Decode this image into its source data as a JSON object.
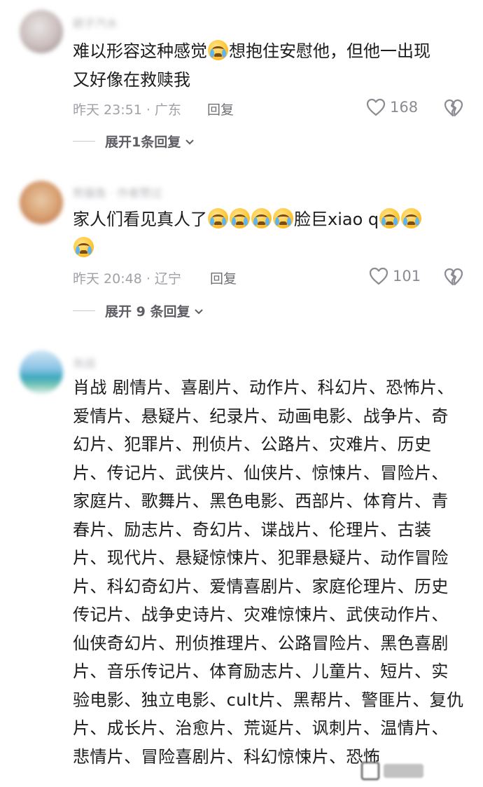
{
  "comments": [
    {
      "username": "颖子汽水",
      "text_a": "难以形容这种感觉",
      "text_b": "想抱住安慰他，但他一出现\n又好像在救赎我",
      "time": "昨天 23:51 · 广东",
      "reply_label": "回复",
      "likes": "168",
      "expand": "展开1条回复",
      "emoji": "crying-face"
    },
    {
      "username": "熊猫鱼 · 作者赞过",
      "text_a": "家人们看见真人了",
      "text_b": "脸巨xiao q",
      "time": "昨天 20:48 · 辽宁",
      "reply_label": "回复",
      "likes": "101",
      "expand": "展开 9 条回复",
      "emoji": "loudly-crying-face"
    },
    {
      "username": "肖战",
      "text": "肖战 剧情片、喜剧片、动作片、科幻片、恐怖片、爱情片、悬疑片、纪录片、动画电影、战争片、奇幻片、犯罪片、刑侦片、公路片、灾难片、历史片、传记片、武侠片、仙侠片、惊悚片、冒险片、家庭片、歌舞片、黑色电影、西部片、体育片、青春片、励志片、奇幻片、谍战片、伦理片、古装片、现代片、悬疑惊悚片、犯罪悬疑片、动作冒险片、科幻奇幻片、爱情喜剧片、家庭伦理片、历史传记片、战争史诗片、灾难惊悚片、武侠动作片、仙侠奇幻片、刑侦推理片、公路冒险片、黑色喜剧片、音乐传记片、体育励志片、儿童片、短片、实验电影、独立电影、cult片、黑帮片、警匪片、复仇片、成长片、治愈片、荒诞片、讽刺片、温情片、悲情片、冒险喜剧片、科幻惊悚片、恐怖"
    }
  ],
  "icons": {
    "heart": "heart-outline-icon",
    "dislike": "broken-heart-icon",
    "chevron": "chevron-down-icon"
  },
  "colors": {
    "text": "#1c1c1e",
    "meta": "#a0a0a8",
    "tear": "#5fb4ef",
    "emoji": "#ffc83a"
  }
}
